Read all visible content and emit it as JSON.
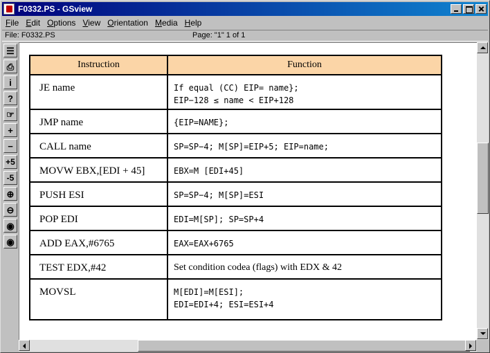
{
  "window": {
    "title": "F0332.PS - GSview"
  },
  "menu": [
    {
      "label": "File",
      "ul": "F",
      "rest": "ile"
    },
    {
      "label": "Edit",
      "ul": "E",
      "rest": "dit"
    },
    {
      "label": "Options",
      "ul": "O",
      "rest": "ptions"
    },
    {
      "label": "View",
      "ul": "V",
      "rest": "iew"
    },
    {
      "label": "Orientation",
      "ul": "O",
      "rest": "rientation"
    },
    {
      "label": "Media",
      "ul": "M",
      "rest": "edia"
    },
    {
      "label": "Help",
      "ul": "H",
      "rest": "elp"
    }
  ],
  "status": {
    "file": "File: F0332.PS",
    "page": "Page: \"1\"  1 of 1"
  },
  "toolbar": [
    {
      "name": "open-icon",
      "glyph": "☰"
    },
    {
      "name": "print-icon",
      "glyph": "⎙"
    },
    {
      "name": "info-icon",
      "glyph": "i"
    },
    {
      "name": "help-icon",
      "glyph": "?"
    },
    {
      "name": "goto-page-icon",
      "glyph": "☞"
    },
    {
      "name": "next-page-icon",
      "glyph": "+"
    },
    {
      "name": "prev-page-icon",
      "glyph": "−"
    },
    {
      "name": "skip-forward-icon",
      "glyph": "+5"
    },
    {
      "name": "skip-back-icon",
      "glyph": "-5"
    },
    {
      "name": "zoom-in-icon",
      "glyph": "⊕"
    },
    {
      "name": "zoom-out-icon",
      "glyph": "⊖"
    },
    {
      "name": "eye-rec-icon",
      "glyph": "◉"
    },
    {
      "name": "eye-icon",
      "glyph": "◉"
    }
  ],
  "table": {
    "headers": {
      "instruction": "Instruction",
      "function": "Function"
    },
    "rows": [
      {
        "instruction": "JE name",
        "function_lines": [
          "If equal (CC) EIP= name};",
          "EIP−128 ≤ name < EIP+128"
        ],
        "serif": false,
        "cls": "row1"
      },
      {
        "instruction": "JMP name",
        "function_lines": [
          "{EIP=NAME};"
        ],
        "serif": false,
        "cls": "rowN"
      },
      {
        "instruction": "CALL name",
        "function_lines": [
          "SP=SP−4; M[SP]=EIP+5; EIP=name;"
        ],
        "serif": false,
        "cls": "rowN"
      },
      {
        "instruction": "MOVW EBX,[EDI + 45]",
        "function_lines": [
          "EBX=M [EDI+45]"
        ],
        "serif": false,
        "cls": "rowN"
      },
      {
        "instruction": "PUSH ESI",
        "function_lines": [
          "SP=SP−4; M[SP]=ESI"
        ],
        "serif": false,
        "cls": "rowN"
      },
      {
        "instruction": "POP EDI",
        "function_lines": [
          "EDI=M[SP]; SP=SP+4"
        ],
        "serif": false,
        "cls": "rowN"
      },
      {
        "instruction": "ADD EAX,#6765",
        "function_lines": [
          "EAX=EAX+6765"
        ],
        "serif": false,
        "cls": "rowN"
      },
      {
        "instruction": "TEST EDX,#42",
        "function_lines": [
          "Set condition codea (flags) with EDX & 42"
        ],
        "serif": true,
        "cls": "rowN"
      },
      {
        "instruction": "MOVSL",
        "function_lines": [
          "M[EDI]=M[ESI];",
          "EDI=EDI+4; ESI=ESI+4"
        ],
        "serif": false,
        "cls": "rowL"
      }
    ]
  }
}
